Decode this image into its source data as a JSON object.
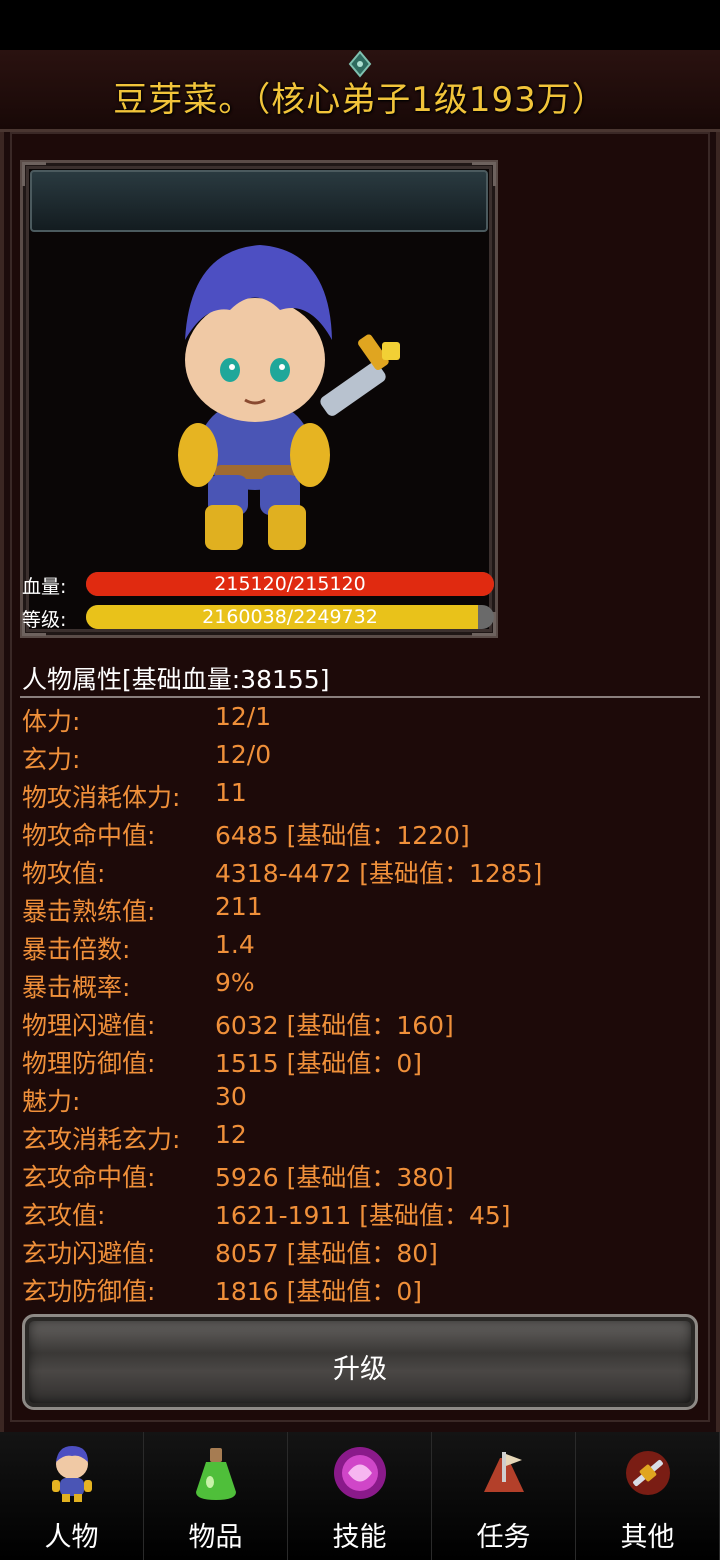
{
  "header": {
    "title": "豆芽菜。（核心弟子1级193万）"
  },
  "character": {
    "avatar_icon": "chibi-swordsman-character",
    "hp": {
      "label": "血量:",
      "text": "215120/215120",
      "fraction": 1.0,
      "color": "#e02a10"
    },
    "level": {
      "label": "等级:",
      "text": "2160038/2249732",
      "fraction": 0.96,
      "color": "#e9c21a"
    }
  },
  "attributes": {
    "header": "人物属性[基础血量:38155]",
    "rows": [
      {
        "name": "体力:",
        "value": "12/1"
      },
      {
        "name": "玄力:",
        "value": "12/0"
      },
      {
        "name": "物攻消耗体力:",
        "value": "11"
      },
      {
        "name": "物攻命中值:",
        "value": "6485 [基础值：1220]"
      },
      {
        "name": "物攻值:",
        "value": "4318-4472 [基础值：1285]"
      },
      {
        "name": "暴击熟练值:",
        "value": "211"
      },
      {
        "name": "暴击倍数:",
        "value": "1.4"
      },
      {
        "name": "暴击概率:",
        "value": "9%"
      },
      {
        "name": "物理闪避值:",
        "value": "6032 [基础值：160]"
      },
      {
        "name": "物理防御值:",
        "value": "1515 [基础值：0]"
      },
      {
        "name": "魅力:",
        "value": "30"
      },
      {
        "name": "玄攻消耗玄力:",
        "value": "12"
      },
      {
        "name": "玄攻命中值:",
        "value": "5926 [基础值：380]"
      },
      {
        "name": "玄攻值:",
        "value": "1621-1911 [基础值：45]"
      },
      {
        "name": "玄功闪避值:",
        "value": "8057 [基础值：80]"
      },
      {
        "name": "玄功防御值:",
        "value": "1816 [基础值：0]"
      }
    ]
  },
  "actions": {
    "upgrade_label": "升级"
  },
  "tabs": [
    {
      "label": "人物",
      "icon": "character-icon",
      "active": true
    },
    {
      "label": "物品",
      "icon": "potion-icon",
      "active": false
    },
    {
      "label": "技能",
      "icon": "skill-orb-icon",
      "active": false
    },
    {
      "label": "任务",
      "icon": "quest-icon",
      "active": false
    },
    {
      "label": "其他",
      "icon": "sword-icon",
      "active": false
    }
  ],
  "colors": {
    "title": "#f2c43a",
    "attribute_text": "#f0903a",
    "background": "#1d0a09"
  }
}
